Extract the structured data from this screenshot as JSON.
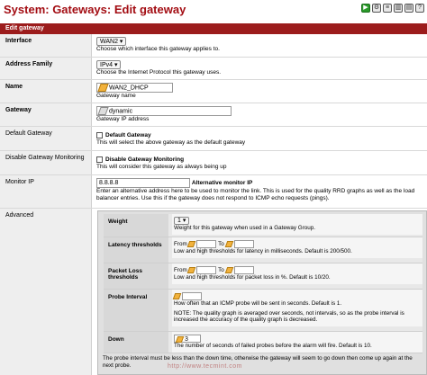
{
  "page": {
    "title": "System: Gateways: Edit gateway",
    "toolbar_icons": [
      "play-icon",
      "gear-icon",
      "list-icon",
      "chart-icon",
      "log-icon",
      "help-icon"
    ]
  },
  "section": {
    "header": "Edit gateway"
  },
  "fields": {
    "interface": {
      "label": "Interface",
      "value": "WAN2",
      "desc": "Choose which interface this gateway applies to."
    },
    "address_family": {
      "label": "Address Family",
      "value": "IPv4",
      "desc": "Choose the Internet Protocol this gateway uses."
    },
    "name": {
      "label": "Name",
      "value": "WAN2_DHCP",
      "desc": "Gateway name"
    },
    "gateway": {
      "label": "Gateway",
      "value": "dynamic",
      "desc": "Gateway IP address"
    },
    "default_gateway": {
      "label": "Default Gateway",
      "check_label": "Default Gateway",
      "desc": "This will select the above gateway as the default gateway"
    },
    "disable_monitoring": {
      "label": "Disable Gateway Monitoring",
      "check_label": "Disable Gateway Monitoring",
      "desc": "This will consider this gateway as always being up"
    },
    "monitor_ip": {
      "label": "Monitor IP",
      "value": "8.8.8.8",
      "suffix": "Alternative monitor IP",
      "desc": "Enter an alternative address here to be used to monitor the link. This is used for the quality RRD graphs as well as the load balancer entries. Use this if the gateway does not respond to ICMP echo requests (pings)."
    },
    "advanced": {
      "label": "Advanced"
    }
  },
  "advanced": {
    "weight": {
      "label": "Weight",
      "value": "1",
      "desc": "Weight for this gateway when used in a Gateway Group."
    },
    "latency": {
      "label": "Latency thresholds",
      "from": "From",
      "to": "To",
      "desc": "Low and high thresholds for latency in milliseconds. Default is 200/500."
    },
    "packet_loss": {
      "label": "Packet Loss thresholds",
      "from": "From",
      "to": "To",
      "desc": "Low and high thresholds for packet loss in %. Default is 10/20."
    },
    "probe_interval": {
      "label": "Probe Interval",
      "desc": "How often that an ICMP probe will be sent in seconds. Default is 1.",
      "note": "NOTE: The quality graph is averaged over seconds, not intervals, so as the probe interval is increased the accuracy of the quality graph is decreased."
    },
    "down": {
      "label": "Down",
      "value": "3",
      "desc": "The number of seconds of failed probes before the alarm will fire. Default is 10."
    },
    "footer": "The probe interval must be less than the down time, otherwise the gateway will seem to go down then come up again at the next probe."
  },
  "watermark": "http://www.tecmint.com"
}
